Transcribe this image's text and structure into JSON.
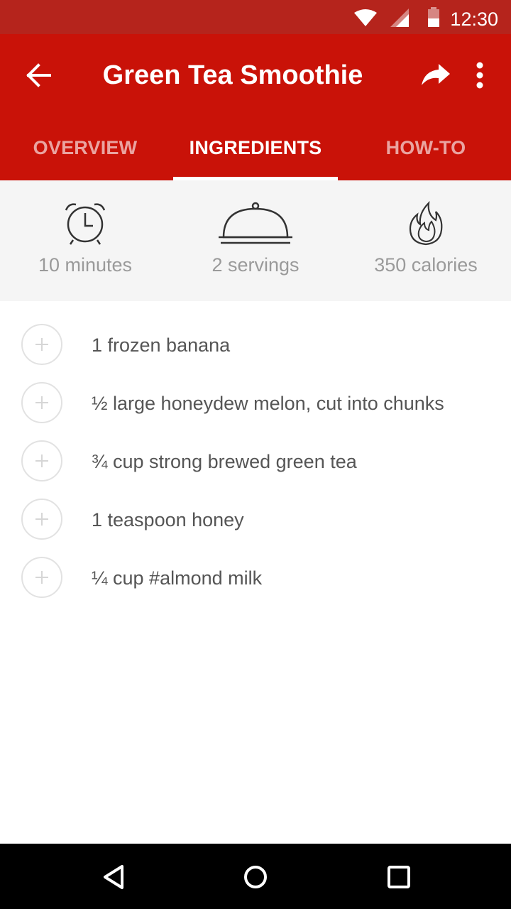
{
  "status_bar": {
    "time": "12:30",
    "icons": [
      "wifi-icon",
      "cell-signal-icon",
      "battery-icon"
    ]
  },
  "app_bar": {
    "title": "Green Tea Smoothie",
    "back_icon": "arrow-back-icon",
    "share_icon": "share-icon",
    "more_icon": "more-vertical-icon"
  },
  "tabs": [
    {
      "label": "OVERVIEW",
      "active": false
    },
    {
      "label": "INGREDIENTS",
      "active": true
    },
    {
      "label": "HOW-TO",
      "active": false
    }
  ],
  "stats": [
    {
      "icon": "alarm-clock-icon",
      "label": "10 minutes"
    },
    {
      "icon": "serving-dish-icon",
      "label": "2 servings"
    },
    {
      "icon": "flame-icon",
      "label": "350 calories"
    }
  ],
  "ingredients": [
    "1 frozen banana",
    "½ large honeydew melon, cut into chunks",
    "¾ cup strong brewed green tea",
    "1 teaspoon honey",
    "¼ cup #almond milk"
  ],
  "nav_bar": {
    "icons": [
      "back-triangle-icon",
      "home-circle-icon",
      "recents-square-icon"
    ]
  },
  "colors": {
    "status_bar": "#b5241c",
    "app_bar": "#c91208",
    "stats_background": "#f5f5f5",
    "text_muted": "#9a9a9a",
    "ingredient_text": "#555555"
  }
}
